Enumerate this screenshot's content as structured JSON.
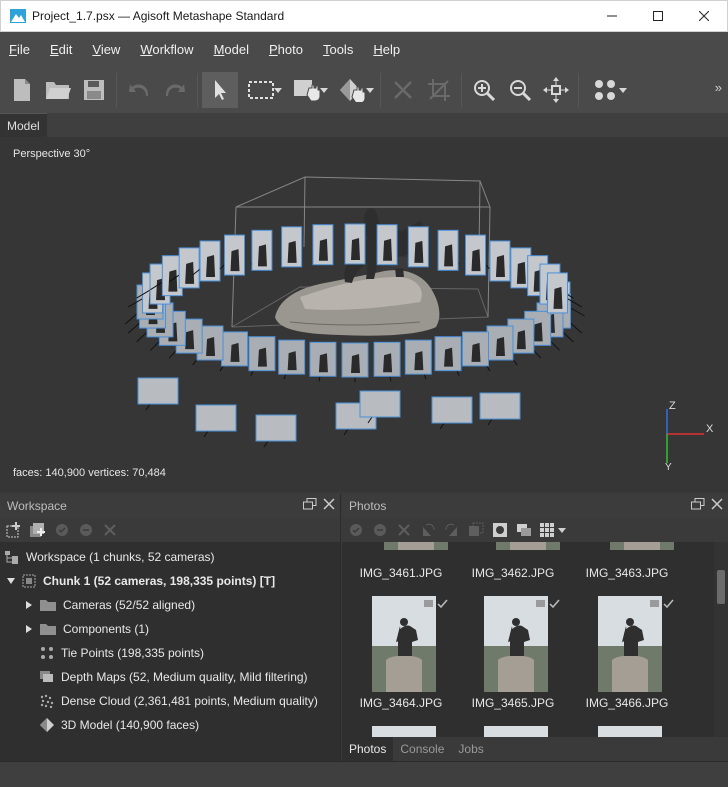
{
  "window": {
    "title": "Project_1.7.psx — Agisoft Metashape Standard"
  },
  "menu": [
    {
      "label": "File",
      "u": "F",
      "rest": "ile"
    },
    {
      "label": "Edit",
      "u": "E",
      "rest": "dit"
    },
    {
      "label": "View",
      "u": "V",
      "rest": "iew"
    },
    {
      "label": "Workflow",
      "u": "W",
      "rest": "orkflow"
    },
    {
      "label": "Model",
      "u": "M",
      "rest": "odel"
    },
    {
      "label": "Photo",
      "u": "P",
      "rest": "hoto"
    },
    {
      "label": "Tools",
      "u": "T",
      "rest": "ools"
    },
    {
      "label": "Help",
      "u": "H",
      "rest": "elp"
    }
  ],
  "model_tab": "Model",
  "viewport": {
    "projection": "Perspective 30°",
    "stats": "faces: 140,900 vertices: 70,484",
    "axis_x": "X",
    "axis_y": "Y",
    "axis_z": "Z"
  },
  "workspace": {
    "title": "Workspace",
    "items": [
      {
        "label": "Workspace (1 chunks, 52 cameras)"
      },
      {
        "label": "Chunk 1 (52 cameras, 198,335 points) [T]"
      },
      {
        "label": "Cameras (52/52 aligned)"
      },
      {
        "label": "Components (1)"
      },
      {
        "label": "Tie Points (198,335 points)"
      },
      {
        "label": "Depth Maps (52, Medium quality, Mild filtering)"
      },
      {
        "label": "Dense Cloud (2,361,481 points, Medium quality)"
      },
      {
        "label": "3D Model (140,900 faces)"
      }
    ]
  },
  "photos": {
    "title": "Photos",
    "row1": [
      "IMG_3461.JPG",
      "IMG_3462.JPG",
      "IMG_3463.JPG"
    ],
    "row2": [
      "IMG_3464.JPG",
      "IMG_3465.JPG",
      "IMG_3466.JPG"
    ]
  },
  "bottom_tabs": [
    "Photos",
    "Console",
    "Jobs"
  ],
  "colors": {
    "axis_x": "#e03030",
    "axis_y": "#30c030",
    "axis_z": "#3070e0",
    "camera_frame": "#4a90d9"
  }
}
